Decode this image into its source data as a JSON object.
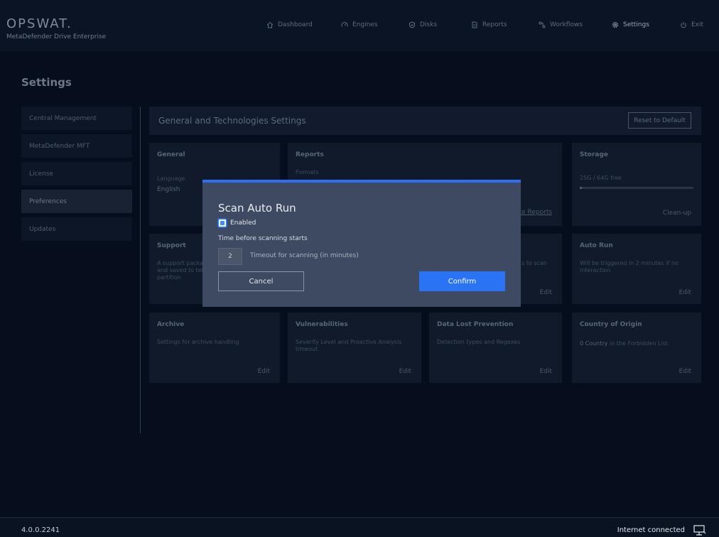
{
  "brand": {
    "logo": "OPSWAT.",
    "product": "MetaDefender Drive Enterprise"
  },
  "nav": {
    "items": [
      {
        "label": "Dashboard",
        "icon": "home-icon"
      },
      {
        "label": "Engines",
        "icon": "gauge-icon"
      },
      {
        "label": "Disks",
        "icon": "shield-icon"
      },
      {
        "label": "Reports",
        "icon": "document-icon"
      },
      {
        "label": "Workflows",
        "icon": "workflow-icon"
      },
      {
        "label": "Settings",
        "icon": "gear-icon"
      },
      {
        "label": "Exit",
        "icon": "power-icon"
      }
    ],
    "active": "Settings"
  },
  "page": {
    "title": "Settings"
  },
  "sidebar": {
    "items": [
      {
        "label": "Central Management"
      },
      {
        "label": "MetaDefender MFT"
      },
      {
        "label": "License"
      },
      {
        "label": "Preferences"
      },
      {
        "label": "Updates"
      }
    ],
    "active": "Preferences"
  },
  "section": {
    "title": "General and Technologies Settings",
    "reset_label": "Reset to Default"
  },
  "cards": {
    "general": {
      "title": "General",
      "desc": "Language",
      "value": "English"
    },
    "reports": {
      "title": "Reports",
      "desc": "Formats",
      "link": "te Reports"
    },
    "storage": {
      "title": "Storage",
      "value": "25G / 64G free",
      "used_fraction": 0.01,
      "action": "Clean-up"
    },
    "support": {
      "title": "Support",
      "desc_line1": "A support packa",
      "desc_line2": "and saved to teh",
      "desc_line3": "partition"
    },
    "middle": {
      "desc": "s to scan",
      "edit": "Edit"
    },
    "autorun": {
      "title": "Auto Run",
      "desc_line1": "Will be triggered in 2 minutes if no",
      "desc_line2": "interaction",
      "edit": "Edit"
    },
    "archive": {
      "title": "Archive",
      "desc": "Settings for archive handling",
      "edit": "Edit"
    },
    "vulnerabilities": {
      "title": "Vulnerabilities",
      "desc_line1": "Severity Level and Proactive Analysis",
      "desc_line2": "timeout",
      "edit": "Edit"
    },
    "dlp": {
      "title": "Data Lost Prevention",
      "desc": "Detection types and Regexes",
      "edit": "Edit"
    },
    "country": {
      "title": "Country of Origin",
      "count": "0 Country",
      "desc": " in the Forbidden List",
      "edit": "Edit"
    }
  },
  "modal": {
    "title": "Scan Auto Run",
    "enabled_label": "Enabled",
    "subtitle": "Time before scanning starts",
    "timeout_value": "2",
    "timeout_caption": "Timeout for scanning (in minutes)",
    "cancel_label": "Cancel",
    "confirm_label": "Confirm"
  },
  "footer": {
    "version": "4.0.0.2241",
    "status": "Internet connected"
  },
  "colors": {
    "accent": "#2b73f5",
    "background": "#060d1d",
    "modal": "#3e4a61"
  }
}
